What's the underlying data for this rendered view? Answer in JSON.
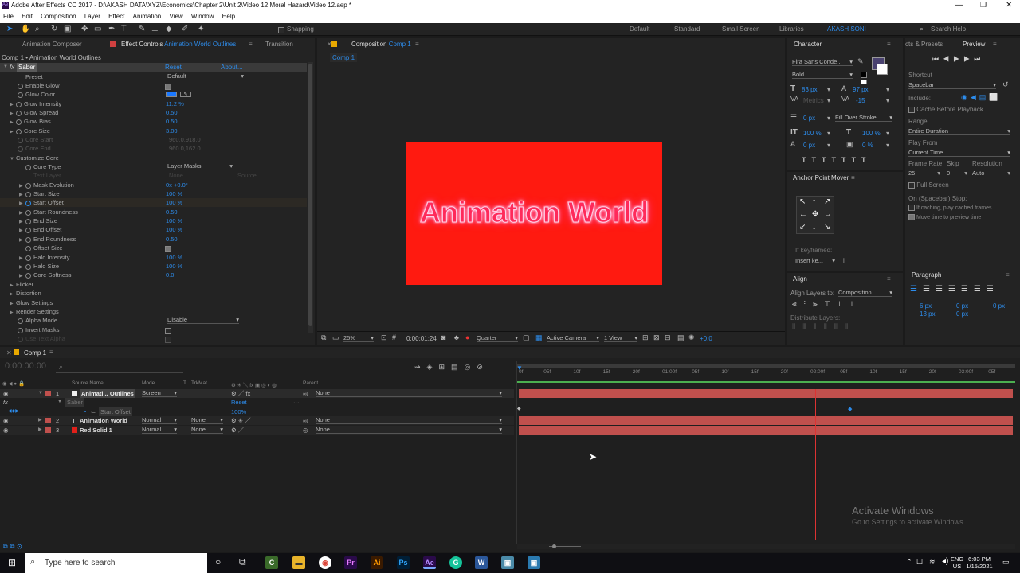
{
  "window": {
    "title": "Adobe After Effects CC 2017 - D:\\AKASH DATA\\XYZ\\Economics\\Chapter 2\\Unit 2\\Video 12 Moral Hazard\\Video 12.aep *"
  },
  "menu": [
    "File",
    "Edit",
    "Composition",
    "Layer",
    "Effect",
    "Animation",
    "View",
    "Window",
    "Help"
  ],
  "toolbar": {
    "snapping_label": "Snapping",
    "workspaces": [
      "Default",
      "Standard",
      "Small Screen",
      "Libraries",
      "AKASH SONI"
    ],
    "search_placeholder": "Search Help"
  },
  "effect_panel": {
    "tab_composer": "Animation Composer",
    "tab_effect": "Effect Controls",
    "tab_effect_layer": "Animation World Outlines",
    "tab_transition": "Transition",
    "breadcrumb": "Comp 1 • Animation World Outlines",
    "fx_name": "Saber",
    "reset": "Reset",
    "about": "About...",
    "props": [
      {
        "label": "Preset",
        "value": "Default"
      },
      {
        "label": "Enable Glow",
        "value": ""
      },
      {
        "label": "Glow Color",
        "value": ""
      },
      {
        "label": "Glow Intensity",
        "value": "11.2 %"
      },
      {
        "label": "Glow Spread",
        "value": "0.50"
      },
      {
        "label": "Glow Bias",
        "value": "0.50"
      },
      {
        "label": "Core Size",
        "value": "3.00"
      },
      {
        "label": "Core Start",
        "value": "960.0,918.0"
      },
      {
        "label": "Core End",
        "value": "960.0,162.0"
      },
      {
        "label": "Customize Core",
        "value": ""
      },
      {
        "label": "Core Type",
        "value": "Layer Masks"
      },
      {
        "label": "Text Layer",
        "value": "None"
      },
      {
        "label": "Mask Evolution",
        "value": "0x +0.0°"
      },
      {
        "label": "Start Size",
        "value": "100 %"
      },
      {
        "label": "Start Offset",
        "value": "100 %"
      },
      {
        "label": "Start Roundness",
        "value": "0.50"
      },
      {
        "label": "End Size",
        "value": "100 %"
      },
      {
        "label": "End Offset",
        "value": "100 %"
      },
      {
        "label": "End Roundness",
        "value": "0.50"
      },
      {
        "label": "Offset Size",
        "value": ""
      },
      {
        "label": "Halo Intensity",
        "value": "100 %"
      },
      {
        "label": "Halo Size",
        "value": "100 %"
      },
      {
        "label": "Core Softness",
        "value": "0.0"
      },
      {
        "label": "Flicker",
        "value": ""
      },
      {
        "label": "Distortion",
        "value": ""
      },
      {
        "label": "Glow Settings",
        "value": ""
      },
      {
        "label": "Render Settings",
        "value": ""
      },
      {
        "label": "Alpha Mode",
        "value": "Disable"
      },
      {
        "label": "Invert Masks",
        "value": ""
      },
      {
        "label": "Use Text Alpha",
        "value": ""
      }
    ],
    "source_label": "Source"
  },
  "comp_panel": {
    "tab": "Composition",
    "tab_name": "Comp 1",
    "crumb": "Comp 1",
    "text": "Animation World",
    "bg_color": "#ff1a10",
    "zoom": "25%",
    "timecode": "0:00:01:24",
    "resolution": "Quarter",
    "camera": "Active Camera",
    "view": "1 View",
    "exposure": "+0.0"
  },
  "character": {
    "title": "Character",
    "font": "Fira Sans Conde...",
    "style": "Bold",
    "size": "83 px",
    "leading": "97 px",
    "kerning": "Metrics",
    "tracking": "-15",
    "stroke": "0 px",
    "stroke_type": "Fill Over Stroke",
    "vscale": "100 %",
    "hscale": "100 %",
    "baseline": "0 px",
    "tsume": "0 %",
    "fill_color": "#4a4270"
  },
  "anchor": {
    "title": "Anchor Point Mover",
    "if_keyframed": "If keyframed:",
    "insert": "Insert ke..."
  },
  "align": {
    "title": "Align",
    "align_to_label": "Align Layers to:",
    "align_to_value": "Composition",
    "distribute": "Distribute Layers:"
  },
  "preview": {
    "tab1": "cts & Presets",
    "tab2": "Preview",
    "shortcut_label": "Shortcut",
    "shortcut_value": "Spacebar",
    "include_label": "Include:",
    "cache_label": "Cache Before Playback",
    "range_label": "Range",
    "range_value": "Entire Duration",
    "playfrom_label": "Play From",
    "playfrom_value": "Current Time",
    "framerate_label": "Frame Rate",
    "skip_label": "Skip",
    "resolution_label": "Resolution",
    "framerate_value": "25",
    "skip_value": "0",
    "resolution_value": "Auto",
    "fullscreen_label": "Full Screen",
    "on_stop_label": "On (Spacebar) Stop:",
    "caching_label": "If caching, play cached frames",
    "move_time_label": "Move time to preview time"
  },
  "paragraph": {
    "title": "Paragraph",
    "indent1": "6 px",
    "indent2": "0 px",
    "indent3": "0 px",
    "space1": "13 px",
    "space2": "0 px"
  },
  "timeline": {
    "tab": "Comp 1",
    "timecode": "0:00:00:00",
    "headers": {
      "source": "Source Name",
      "mode": "Mode",
      "t": "T",
      "trkmat": "TrkMat",
      "parent": "Parent"
    },
    "layers": [
      {
        "num": "1",
        "name": "Animati... Outlines",
        "mode": "Screen",
        "trkmat": "",
        "parent": "None",
        "color": "#c0504d"
      },
      {
        "num": "2",
        "name": "Animation World",
        "mode": "Normal",
        "trkmat": "None",
        "parent": "None",
        "color": "#c0504d"
      },
      {
        "num": "3",
        "name": "Red Solid 1",
        "mode": "Normal",
        "trkmat": "None",
        "parent": "None",
        "color": "#e0201a"
      }
    ],
    "sub_effect": "Saber",
    "sub_reset": "Reset",
    "sub_prop": "Start Offset",
    "sub_value": "100%",
    "ruler": [
      "0f",
      "05f",
      "10f",
      "15f",
      "20f",
      "01:00f",
      "05f",
      "10f",
      "15f",
      "20f",
      "02:00f",
      "05f",
      "10f",
      "15f",
      "20f",
      "03:00f",
      "05f"
    ]
  },
  "watermark": {
    "line1": "Activate Windows",
    "line2": "Go to Settings to activate Windows."
  },
  "taskbar": {
    "search_placeholder": "Type here to search",
    "lang1": "ENG",
    "lang2": "US",
    "time": "6:03 PM",
    "date": "1/15/2021"
  }
}
